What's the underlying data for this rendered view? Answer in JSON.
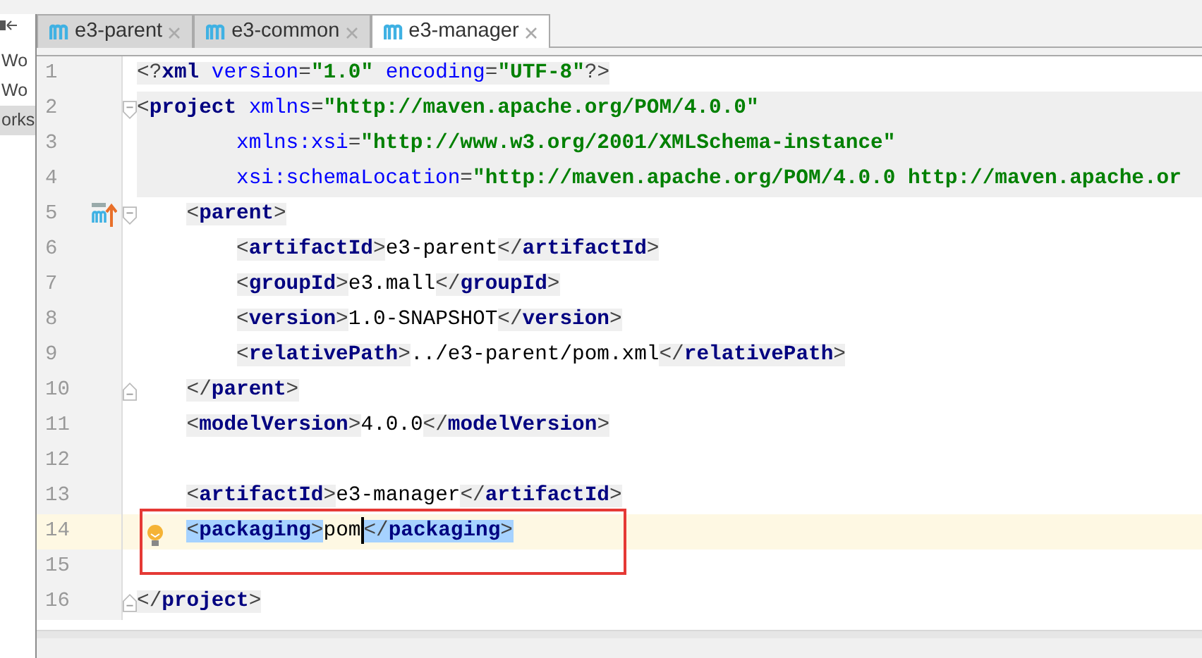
{
  "sidebar": {
    "items": [
      {
        "label": "Wo",
        "selected": false
      },
      {
        "label": "Wo",
        "selected": false
      },
      {
        "label": "orks",
        "selected": true
      }
    ]
  },
  "tabs": [
    {
      "label": "e3-parent",
      "selected": false
    },
    {
      "label": "e3-common",
      "selected": false
    },
    {
      "label": "e3-manager",
      "selected": true
    }
  ],
  "editor": {
    "lines": [
      {
        "number": "1",
        "current": false,
        "shaded": false,
        "matched": false,
        "code": "<?xml version=\"1.0\" encoding=\"UTF-8\"?>"
      },
      {
        "number": "2",
        "current": false,
        "shaded": true,
        "matched": false,
        "fold": {
          "kind": "open"
        },
        "code": "<project xmlns=\"http://maven.apache.org/POM/4.0.0\""
      },
      {
        "number": "3",
        "current": false,
        "shaded": true,
        "code": "        xmlns:xsi=\"http://www.w3.org/2001/XMLSchema-instance\""
      },
      {
        "number": "4",
        "current": false,
        "shaded": true,
        "code": "        xsi:schemaLocation=\"http://maven.apache.org/POM/4.0.0 http://maven.apache.or"
      },
      {
        "number": "5",
        "current": false,
        "shaded": false,
        "matched": false,
        "fold": {
          "kind": "open"
        },
        "gutter_icon": {
          "kind": "override"
        },
        "code": "    <parent>"
      },
      {
        "number": "6",
        "current": false,
        "shaded": false,
        "matched": false,
        "code": "        <artifactId>e3-parent</artifactId>"
      },
      {
        "number": "7",
        "current": false,
        "shaded": false,
        "matched": false,
        "code": "        <groupId>e3.mall</groupId>"
      },
      {
        "number": "8",
        "current": false,
        "shaded": false,
        "matched": false,
        "code": "        <version>1.0-SNAPSHOT</version>"
      },
      {
        "number": "9",
        "current": false,
        "shaded": false,
        "matched": false,
        "code": "        <relativePath>../e3-parent/pom.xml</relativePath>"
      },
      {
        "number": "10",
        "current": false,
        "shaded": false,
        "matched": false,
        "fold": {
          "kind": "close"
        },
        "code": "    </parent>"
      },
      {
        "number": "11",
        "current": false,
        "shaded": false,
        "matched": false,
        "code": "    <modelVersion>4.0.0</modelVersion>"
      },
      {
        "number": "12",
        "current": false,
        "shaded": false
      },
      {
        "number": "13",
        "current": false,
        "shaded": false,
        "matched": false,
        "code": "    <artifactId>e3-manager</artifactId>"
      },
      {
        "number": "14",
        "current": true,
        "shaded": false,
        "matched": true,
        "gutter_icon": {
          "kind": "bulb"
        },
        "code": "    <packaging>pom",
        "code_after_caret": "</packaging>"
      },
      {
        "number": "15",
        "current": false,
        "shaded": false
      },
      {
        "number": "16",
        "current": false,
        "shaded": false,
        "matched": false,
        "fold": {
          "kind": "close"
        },
        "code": "</project>"
      }
    ]
  },
  "annotation": {
    "kind": "rectangle"
  }
}
